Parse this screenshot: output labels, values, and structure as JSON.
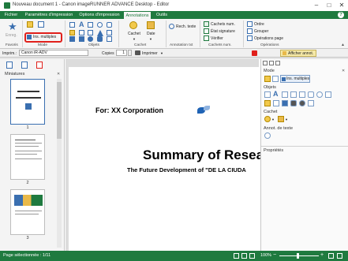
{
  "window": {
    "title": "Nouveau document 1 - Canon imageRUNNER ADVANCE Desktop - Editor",
    "help_label": "?"
  },
  "tabs": [
    {
      "label": "Fichier"
    },
    {
      "label": "Paramètres d'impression"
    },
    {
      "label": "Options d'impression"
    },
    {
      "label": "Annotations"
    },
    {
      "label": "Outils"
    }
  ],
  "ribbon": {
    "favorites": {
      "enreg_label": "Enreg.",
      "group_label": "Favoris"
    },
    "mode": {
      "ins_multiples_label": "Ins. multiples",
      "group_label": "Mode"
    },
    "objects": {
      "group_label": "Objets"
    },
    "stamp": {
      "cachet_label": "Cachet",
      "date_label": "Date",
      "group_label": "Cachet"
    },
    "text_annotation": {
      "rech_texte_label": "Rech. texte",
      "group_label": "Annotation txt"
    },
    "digital_stamps": {
      "cachets_num_label": "Cachets num.",
      "etat_signature_label": "État signature",
      "verifier_label": "Vérifier",
      "group_label": "Cachets num."
    },
    "operations": {
      "ordre_label": "Ordre",
      "grouper_label": "Grouper",
      "operations_page_label": "Opérations page",
      "group_label": "Opérations"
    }
  },
  "toolbar": {
    "printer_label": "Imprim.:",
    "printer_value": "Canon iR-ADV",
    "copies_label": "Copies",
    "copies_value": "1",
    "print_button_label": "Imprimer",
    "show_annot_label": "Afficher annot."
  },
  "thumbnails": {
    "title": "Miniatures",
    "pages": [
      {
        "number": "1"
      },
      {
        "number": "2"
      },
      {
        "number": "3"
      }
    ]
  },
  "document": {
    "for_line": "For: XX Corporation",
    "title": "Summary of Resea",
    "subtitle": "The Future Development of \"DE LA CIUDA"
  },
  "right_panel": {
    "mode_label": "Mode",
    "ins_multiples_label": "Ins. multiples",
    "objects_label": "Objets",
    "stamp_label": "Cachet",
    "text_annot_label": "Annot. de texte",
    "properties_label": "Propriétés"
  },
  "status_bar": {
    "page_selection": "Page sélectionnée : 1/11",
    "zoom": "100%"
  },
  "colors": {
    "brand_green": "#1f7a3f",
    "highlight_red": "#e0201b",
    "accent_blue": "#3a6fb0"
  }
}
